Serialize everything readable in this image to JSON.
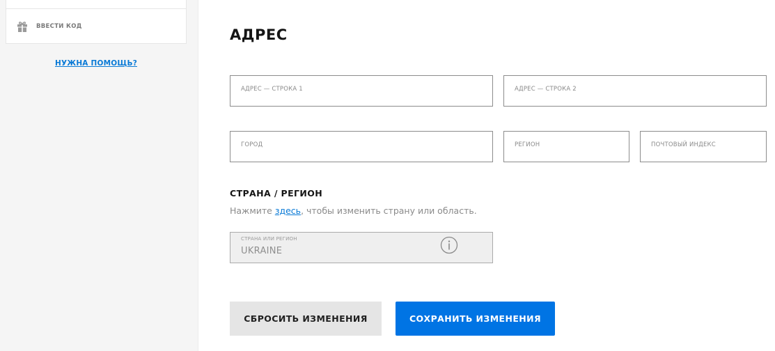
{
  "sidebar": {
    "items": [
      {
        "label": "ВВЕСТИ КОД",
        "icon": "gift-icon"
      }
    ],
    "help_link": "НУЖНА ПОМОЩЬ?"
  },
  "address": {
    "title": "АДРЕС",
    "fields": {
      "line1": {
        "label": "АДРЕС — СТРОКА 1",
        "value": ""
      },
      "line2": {
        "label": "АДРЕС — СТРОКА 2",
        "value": ""
      },
      "city": {
        "label": "ГОРОД",
        "value": ""
      },
      "region": {
        "label": "РЕГИОН",
        "value": ""
      },
      "postal": {
        "label": "ПОЧТОВЫЙ ИНДЕКС",
        "value": ""
      }
    }
  },
  "country": {
    "title": "СТРАНА / РЕГИОН",
    "hint_before": "Нажмите ",
    "hint_link": "здесь",
    "hint_after": ", чтобы изменить страну или область.",
    "field_label": "СТРАНА ИЛИ РЕГИОН",
    "value": "UKRAINE",
    "info_icon": "info-icon"
  },
  "actions": {
    "reset_label": "СБРОСИТЬ ИЗМЕНЕНИЯ",
    "save_label": "СОХРАНИТЬ ИЗМЕНЕНИЯ"
  },
  "colors": {
    "accent": "#0074e4",
    "link": "#0a7ad6",
    "sidebar_bg": "#f5f5f5"
  }
}
